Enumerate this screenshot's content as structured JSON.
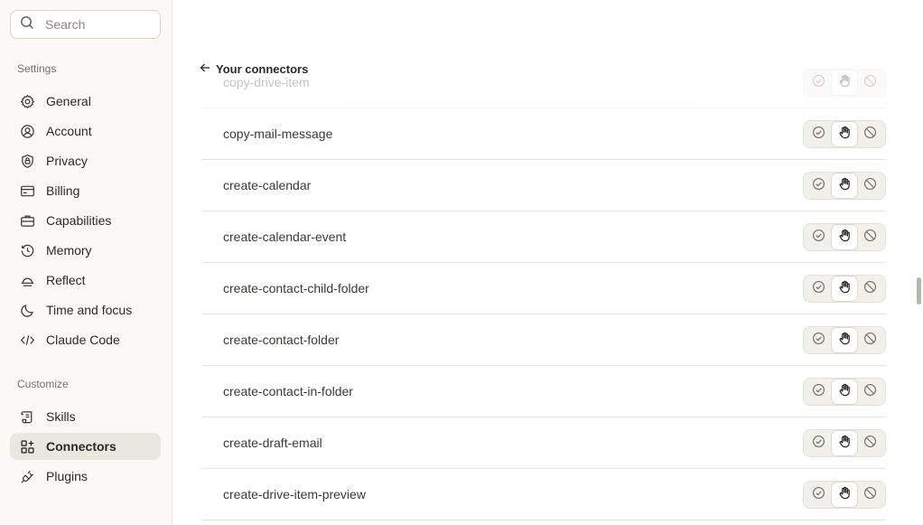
{
  "sidebar": {
    "search_placeholder": "Search",
    "settings_label": "Settings",
    "settings_items": [
      {
        "label": "General",
        "icon": "gear-icon"
      },
      {
        "label": "Account",
        "icon": "user-circle-icon"
      },
      {
        "label": "Privacy",
        "icon": "shield-icon"
      },
      {
        "label": "Billing",
        "icon": "card-icon"
      },
      {
        "label": "Capabilities",
        "icon": "briefcase-icon"
      },
      {
        "label": "Memory",
        "icon": "history-icon"
      },
      {
        "label": "Reflect",
        "icon": "sunrise-icon"
      },
      {
        "label": "Time and focus",
        "icon": "moon-icon"
      },
      {
        "label": "Claude Code",
        "icon": "code-icon"
      }
    ],
    "customize_label": "Customize",
    "customize_items": [
      {
        "label": "Skills",
        "icon": "scroll-icon"
      },
      {
        "label": "Connectors",
        "icon": "grid-plus-icon",
        "active": true
      },
      {
        "label": "Plugins",
        "icon": "plug-icon"
      }
    ]
  },
  "main": {
    "back_label": "Your connectors",
    "tools": [
      {
        "name": "copy-drive-item"
      },
      {
        "name": "copy-mail-message"
      },
      {
        "name": "create-calendar"
      },
      {
        "name": "create-calendar-event"
      },
      {
        "name": "create-contact-child-folder"
      },
      {
        "name": "create-contact-folder"
      },
      {
        "name": "create-contact-in-folder"
      },
      {
        "name": "create-draft-email"
      },
      {
        "name": "create-drive-item-preview"
      }
    ]
  },
  "colors": {
    "sidebar_bg": "#faf9f5",
    "active_bg": "#e9e7e0",
    "segment_bg": "#f2f0eb"
  }
}
